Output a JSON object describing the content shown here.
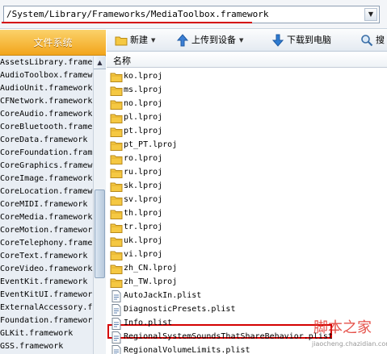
{
  "address": {
    "path": "/System/Library/Frameworks/MediaToolbox.framework"
  },
  "sidebar": {
    "tab_label": "文件系统",
    "items": [
      "AssetsLibrary.frame",
      "AudioToolbox.framew",
      "AudioUnit.framework",
      "CFNetwork.framework",
      "CoreAudio.framework",
      "CoreBluetooth.frame",
      "CoreData.framework",
      "CoreFoundation.fram",
      "CoreGraphics.framew",
      "CoreImage.framework",
      "CoreLocation.framew",
      "CoreMIDI.framework",
      "CoreMedia.framework",
      "CoreMotion.framewor",
      "CoreTelephony.frame",
      "CoreText.framework",
      "CoreVideo.framework",
      "EventKit.framework",
      "EventKitUI.framewor",
      "ExternalAccessory.f",
      "Foundation.framewor",
      "GLKit.framework",
      "GSS.framework"
    ]
  },
  "toolbar": {
    "new_label": "新建",
    "upload_label": "上传到设备",
    "download_label": "下载到电脑",
    "search_label": "搜"
  },
  "list_header": {
    "name_label": "名称"
  },
  "files": [
    {
      "name": "ko.lproj",
      "type": "folder"
    },
    {
      "name": "ms.lproj",
      "type": "folder"
    },
    {
      "name": "no.lproj",
      "type": "folder"
    },
    {
      "name": "pl.lproj",
      "type": "folder"
    },
    {
      "name": "pt.lproj",
      "type": "folder"
    },
    {
      "name": "pt_PT.lproj",
      "type": "folder"
    },
    {
      "name": "ro.lproj",
      "type": "folder"
    },
    {
      "name": "ru.lproj",
      "type": "folder"
    },
    {
      "name": "sk.lproj",
      "type": "folder"
    },
    {
      "name": "sv.lproj",
      "type": "folder"
    },
    {
      "name": "th.lproj",
      "type": "folder"
    },
    {
      "name": "tr.lproj",
      "type": "folder"
    },
    {
      "name": "uk.lproj",
      "type": "folder"
    },
    {
      "name": "vi.lproj",
      "type": "folder"
    },
    {
      "name": "zh_CN.lproj",
      "type": "folder"
    },
    {
      "name": "zh_TW.lproj",
      "type": "folder"
    },
    {
      "name": "AutoJackIn.plist",
      "type": "file"
    },
    {
      "name": "DiagnosticPresets.plist",
      "type": "file"
    },
    {
      "name": "Info.plist",
      "type": "file"
    },
    {
      "name": "RegionalSystemSoundsThatShareBehavior.plist",
      "type": "file"
    },
    {
      "name": "RegionalVolumeLimits.plist",
      "type": "file"
    }
  ],
  "watermark": {
    "title": "脚本之家",
    "url": "jiaocheng.chazidian.com"
  },
  "colors": {
    "tab_orange": "#f2a51c",
    "highlight_red": "#d40000",
    "folder_yellow": "#f5c842"
  }
}
